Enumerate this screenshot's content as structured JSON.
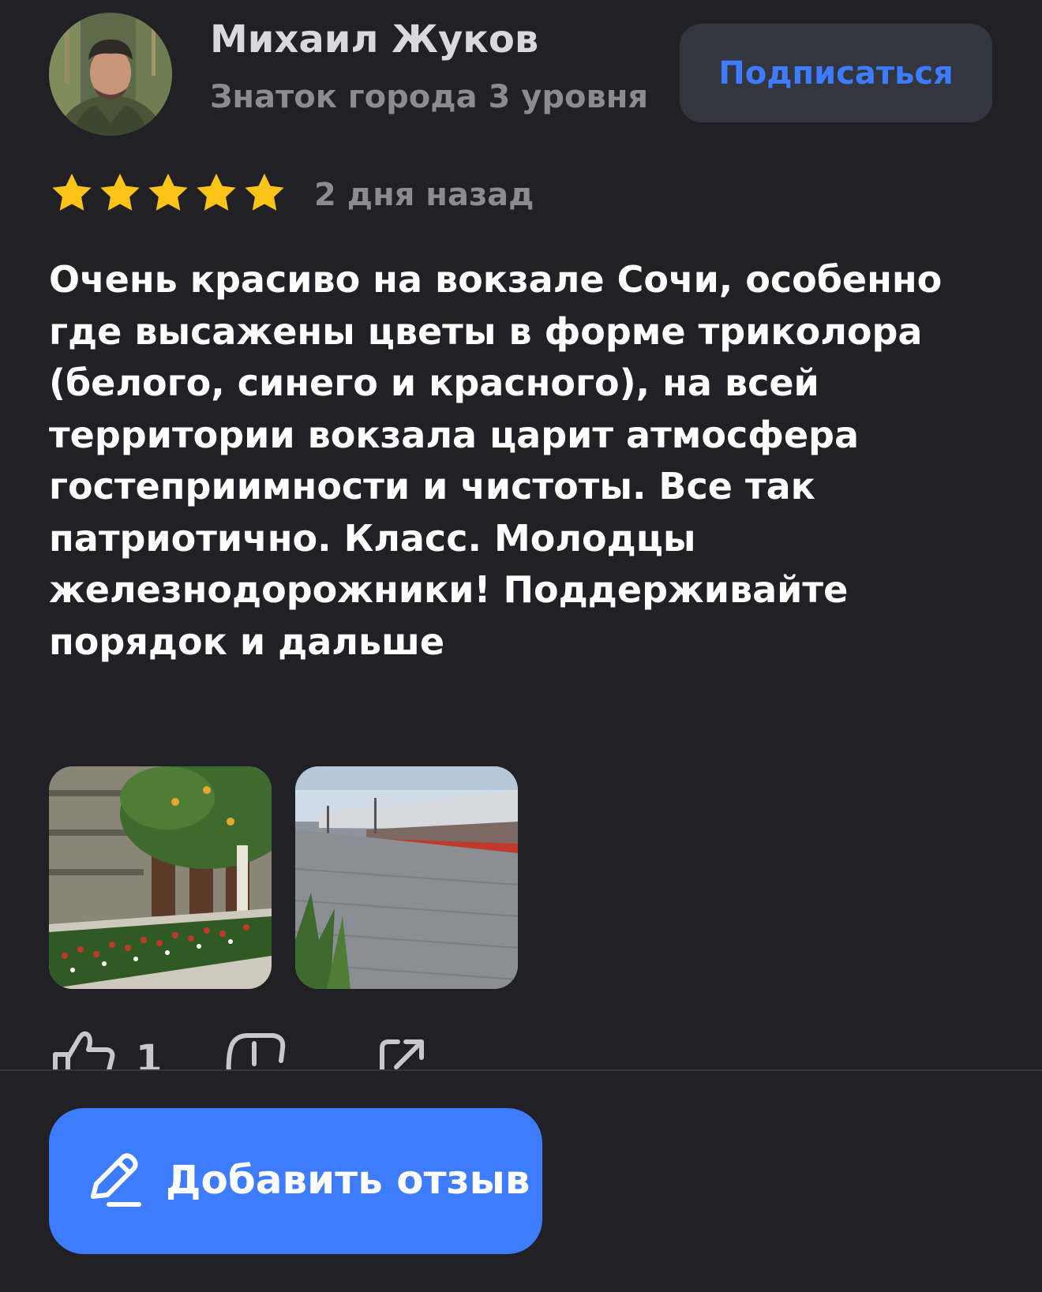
{
  "author": {
    "name": "Михаил Жуков",
    "level": "Знаток города 3 уровня",
    "avatar_icon": "user-photo"
  },
  "subscribe": {
    "label": "Подписаться"
  },
  "review": {
    "rating": 5,
    "rating_max": 5,
    "date": "2 дня назад",
    "text": "Очень красиво на вокзале Сочи, особенно где высажены цветы в форме триколора (белого, синего и красного), на всей территории вокзала царит атмосфера гостеприимности и чистоты. Все так патриотично. Класс. Молодцы железнодорожники! Поддерживайте порядок и дальше"
  },
  "photos": [
    {
      "name": "photo-station-flowerbed"
    },
    {
      "name": "photo-station-platform"
    }
  ],
  "actions": {
    "like_count": "1",
    "icons": [
      "thumb-up-icon",
      "comment-icon",
      "share-icon"
    ]
  },
  "add_review": {
    "label": "Добавить отзыв",
    "icon": "pencil-icon"
  },
  "colors": {
    "background": "#212125",
    "accent": "#3d7bff",
    "star": "#fcc419",
    "secondary_text": "#8b8b90",
    "subscribe_bg": "#34363f"
  }
}
